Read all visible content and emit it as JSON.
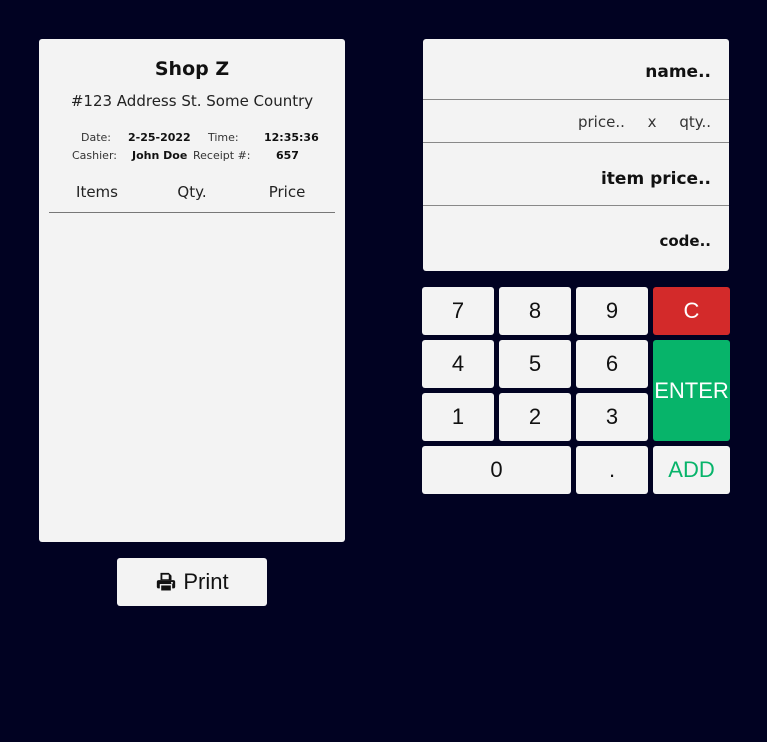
{
  "receipt": {
    "shop_name": "Shop Z",
    "address": "#123 Address St. Some Country",
    "date_label": "Date:",
    "date_value": "2-25-2022",
    "time_label": "Time:",
    "time_value": "12:35:36",
    "cashier_label": "Cashier:",
    "cashier_value": "John Doe",
    "receipt_label": "Receipt #:",
    "receipt_value": "657",
    "columns": [
      "Items",
      "Qty.",
      "Price"
    ]
  },
  "print_button": {
    "label": "Print",
    "icon": "printer-icon"
  },
  "entry": {
    "name_placeholder": "name..",
    "price_placeholder": "price..",
    "times_symbol": "x",
    "qty_placeholder": "qty..",
    "item_price_placeholder": "item price..",
    "code_placeholder": "code.."
  },
  "keypad": {
    "k7": "7",
    "k8": "8",
    "k9": "9",
    "clear": "C",
    "k4": "4",
    "k5": "5",
    "k6": "6",
    "enter": "ENTER",
    "k1": "1",
    "k2": "2",
    "k3": "3",
    "k0": "0",
    "dot": ".",
    "add": "ADD"
  },
  "colors": {
    "background": "#010222",
    "panel": "#f3f3f3",
    "clear_key": "#d32a2a",
    "enter_key": "#07b46a",
    "add_text": "#07b46a"
  }
}
